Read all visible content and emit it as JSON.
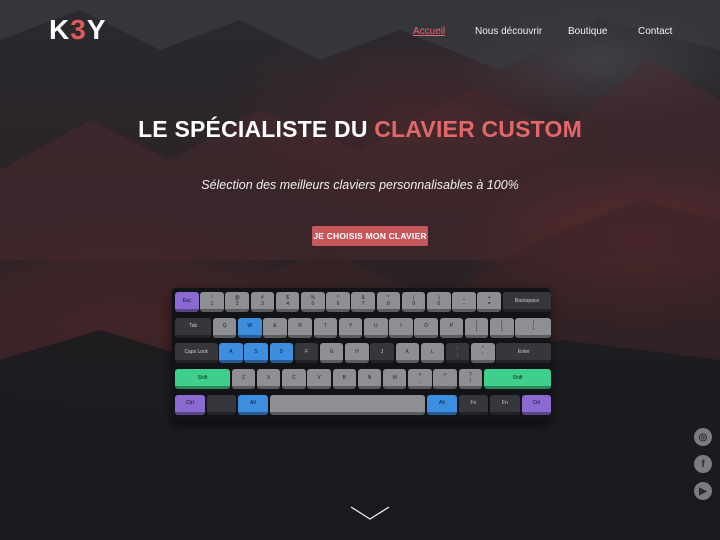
{
  "brand": {
    "logo_part1": "K",
    "logo_part2": "3",
    "logo_part3": "Y"
  },
  "nav": {
    "items": [
      {
        "label": "Accueil",
        "active": true
      },
      {
        "label": "Nous découvrir",
        "active": false
      },
      {
        "label": "Boutique",
        "active": false
      },
      {
        "label": "Contact",
        "active": false
      }
    ]
  },
  "hero": {
    "title_main": "LE SPÉCIALISTE DU ",
    "title_accent": "CLAVIER CUSTOM",
    "subtitle": "Sélection des meilleurs claviers personnalisables à 100%",
    "cta_label": "JE CHOISIS MON CLAVIER"
  },
  "keyboard": {
    "rows": [
      [
        {
          "top": "Esc",
          "bottom": "",
          "color": "purple",
          "w": 1
        },
        {
          "top": "!",
          "bottom": "1",
          "color": "gray",
          "w": 1
        },
        {
          "top": "@",
          "bottom": "2",
          "color": "gray",
          "w": 1
        },
        {
          "top": "#",
          "bottom": "3",
          "color": "gray",
          "w": 1
        },
        {
          "top": "$",
          "bottom": "4",
          "color": "gray",
          "w": 1
        },
        {
          "top": "%",
          "bottom": "5",
          "color": "gray",
          "w": 1
        },
        {
          "top": "^",
          "bottom": "6",
          "color": "gray",
          "w": 1
        },
        {
          "top": "&",
          "bottom": "7",
          "color": "gray",
          "w": 1
        },
        {
          "top": "*",
          "bottom": "8",
          "color": "gray",
          "w": 1
        },
        {
          "top": "(",
          "bottom": "9",
          "color": "gray",
          "w": 1
        },
        {
          "top": ")",
          "bottom": "0",
          "color": "gray",
          "w": 1
        },
        {
          "top": "_",
          "bottom": "-",
          "color": "gray",
          "w": 1
        },
        {
          "top": "+",
          "bottom": "=",
          "color": "gray",
          "w": 1
        },
        {
          "top": "Backspace",
          "bottom": "",
          "color": "dark",
          "w": 2
        }
      ],
      [
        {
          "top": "Tab",
          "bottom": "",
          "color": "dark",
          "w": 1.5
        },
        {
          "top": "Q",
          "bottom": "",
          "color": "gray",
          "w": 1
        },
        {
          "top": "W",
          "bottom": "",
          "color": "blue",
          "w": 1
        },
        {
          "top": "E",
          "bottom": "",
          "color": "gray",
          "w": 1
        },
        {
          "top": "R",
          "bottom": "",
          "color": "gray",
          "w": 1
        },
        {
          "top": "T",
          "bottom": "",
          "color": "gray",
          "w": 1
        },
        {
          "top": "Y",
          "bottom": "",
          "color": "gray",
          "w": 1
        },
        {
          "top": "U",
          "bottom": "",
          "color": "gray",
          "w": 1
        },
        {
          "top": "I",
          "bottom": "",
          "color": "gray",
          "w": 1
        },
        {
          "top": "O",
          "bottom": "",
          "color": "gray",
          "w": 1
        },
        {
          "top": "P",
          "bottom": "",
          "color": "gray",
          "w": 1
        },
        {
          "top": "{",
          "bottom": "[",
          "color": "gray",
          "w": 1
        },
        {
          "top": "}",
          "bottom": "]",
          "color": "gray",
          "w": 1
        },
        {
          "top": "|",
          "bottom": "\\",
          "color": "gray",
          "w": 1.5
        }
      ],
      [
        {
          "top": "Caps Lock",
          "bottom": "",
          "color": "dark",
          "w": 1.75
        },
        {
          "top": "A",
          "bottom": "",
          "color": "blue",
          "w": 1
        },
        {
          "top": "S",
          "bottom": "",
          "color": "blue",
          "w": 1
        },
        {
          "top": "D",
          "bottom": "",
          "color": "blue",
          "w": 1
        },
        {
          "top": "F",
          "bottom": "",
          "color": "dark",
          "w": 1
        },
        {
          "top": "G",
          "bottom": "",
          "color": "gray",
          "w": 1
        },
        {
          "top": "H",
          "bottom": "",
          "color": "gray",
          "w": 1
        },
        {
          "top": "J",
          "bottom": "",
          "color": "dark",
          "w": 1
        },
        {
          "top": "K",
          "bottom": "",
          "color": "gray",
          "w": 1
        },
        {
          "top": "L",
          "bottom": "",
          "color": "gray",
          "w": 1
        },
        {
          "top": ":",
          "bottom": ";",
          "color": "dark",
          "w": 1
        },
        {
          "top": "\"",
          "bottom": "'",
          "color": "gray",
          "w": 1
        },
        {
          "top": "Enter",
          "bottom": "",
          "color": "dark",
          "w": 2.25
        }
      ],
      [
        {
          "top": "Shift",
          "bottom": "",
          "color": "green",
          "w": 2.25
        },
        {
          "top": "Z",
          "bottom": "",
          "color": "gray",
          "w": 1
        },
        {
          "top": "X",
          "bottom": "",
          "color": "gray",
          "w": 1
        },
        {
          "top": "C",
          "bottom": "",
          "color": "gray",
          "w": 1
        },
        {
          "top": "V",
          "bottom": "",
          "color": "gray",
          "w": 1
        },
        {
          "top": "B",
          "bottom": "",
          "color": "gray",
          "w": 1
        },
        {
          "top": "N",
          "bottom": "",
          "color": "gray",
          "w": 1
        },
        {
          "top": "M",
          "bottom": "",
          "color": "gray",
          "w": 1
        },
        {
          "top": "<",
          "bottom": ",",
          "color": "gray",
          "w": 1
        },
        {
          "top": ">",
          "bottom": ".",
          "color": "gray",
          "w": 1
        },
        {
          "top": "?",
          "bottom": "/",
          "color": "gray",
          "w": 1
        },
        {
          "top": "Shift",
          "bottom": "",
          "color": "green",
          "w": 2.75
        }
      ],
      [
        {
          "top": "Ctrl",
          "bottom": "",
          "color": "purple",
          "w": 1.25
        },
        {
          "top": "",
          "bottom": "",
          "color": "dark",
          "w": 1.25
        },
        {
          "top": "Alt",
          "bottom": "",
          "color": "blue",
          "w": 1.25
        },
        {
          "top": "",
          "bottom": "",
          "color": "gray",
          "w": 6.25
        },
        {
          "top": "Alt",
          "bottom": "",
          "color": "blue",
          "w": 1.25
        },
        {
          "top": "Fn",
          "bottom": "",
          "color": "dark",
          "w": 1.25
        },
        {
          "top": "Fn",
          "bottom": "",
          "color": "dark",
          "w": 1.25
        },
        {
          "top": "Ctrl",
          "bottom": "",
          "color": "purple",
          "w": 1.25
        }
      ]
    ]
  },
  "social": [
    {
      "name": "instagram-icon",
      "glyph": "◎"
    },
    {
      "name": "facebook-icon",
      "glyph": "f"
    },
    {
      "name": "youtube-icon",
      "glyph": "▶"
    }
  ],
  "scroll": {
    "icon": "chevron-down-icon"
  }
}
